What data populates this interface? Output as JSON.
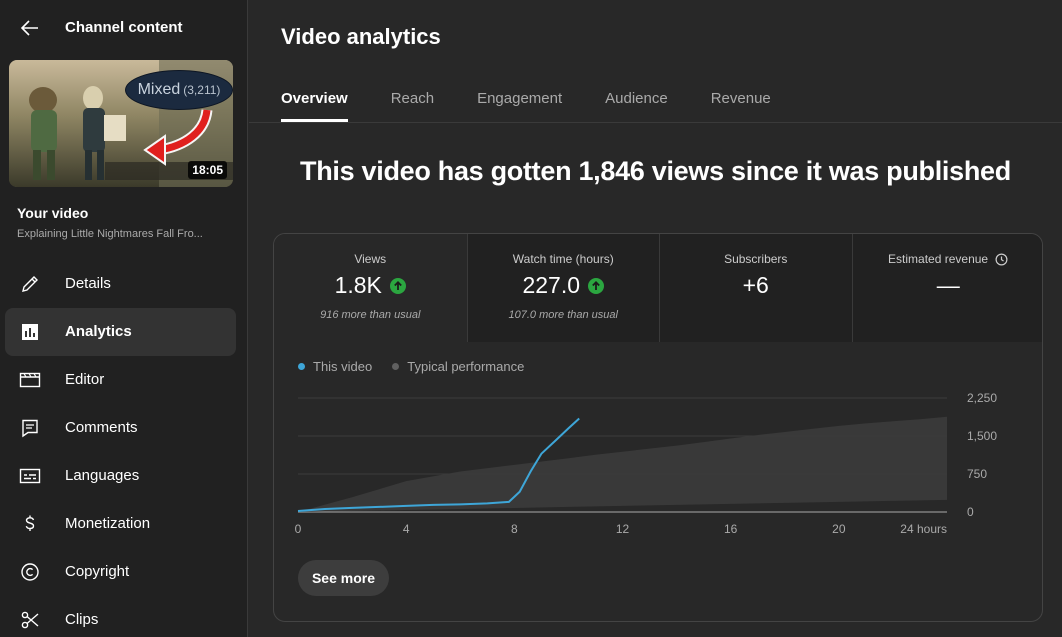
{
  "sidebar": {
    "title": "Channel content",
    "thumbnail": {
      "badge_word": "Mixed",
      "badge_count": "(3,211)",
      "duration": "18:05"
    },
    "your_video_label": "Your video",
    "video_title": "Explaining Little Nightmares Fall Fro...",
    "items": [
      {
        "label": "Details",
        "icon": "pencil-icon"
      },
      {
        "label": "Analytics",
        "icon": "analytics-icon",
        "active": true
      },
      {
        "label": "Editor",
        "icon": "editor-icon"
      },
      {
        "label": "Comments",
        "icon": "comments-icon"
      },
      {
        "label": "Languages",
        "icon": "languages-icon"
      },
      {
        "label": "Monetization",
        "icon": "dollar-icon"
      },
      {
        "label": "Copyright",
        "icon": "copyright-icon"
      },
      {
        "label": "Clips",
        "icon": "scissors-icon"
      }
    ]
  },
  "main": {
    "title": "Video analytics",
    "tabs": [
      {
        "label": "Overview",
        "active": true
      },
      {
        "label": "Reach"
      },
      {
        "label": "Engagement"
      },
      {
        "label": "Audience"
      },
      {
        "label": "Revenue"
      }
    ],
    "headline": "This video has gotten 1,846 views since it was published",
    "metrics": [
      {
        "label": "Views",
        "value": "1.8K",
        "trend": "up",
        "note": "916 more than usual"
      },
      {
        "label": "Watch time (hours)",
        "value": "227.0",
        "trend": "up",
        "note": "107.0 more than usual"
      },
      {
        "label": "Subscribers",
        "value": "+6",
        "note": ""
      },
      {
        "label": "Estimated revenue",
        "value": "—",
        "note": ""
      }
    ],
    "legend": {
      "this_video": "This video",
      "typical": "Typical performance"
    },
    "see_more": "See more"
  },
  "colors": {
    "this_video": "#3ea6d8",
    "typical": "#3a3a3a",
    "up_badge": "#2ba640"
  },
  "chart_data": {
    "type": "line",
    "x_tick_labels": [
      "0",
      "4",
      "8",
      "12",
      "16",
      "20",
      "24 hours"
    ],
    "x_ticks": [
      0,
      4,
      8,
      12,
      16,
      20,
      24
    ],
    "y_tick_labels": [
      "2,250",
      "1,500",
      "750",
      "0"
    ],
    "y_ticks": [
      2250,
      1500,
      750,
      0
    ],
    "xlim": [
      0,
      24
    ],
    "ylim": [
      0,
      2250
    ],
    "grid": true,
    "legend_position": "top-left",
    "series": [
      {
        "name": "This video",
        "x": [
          0,
          1,
          2,
          3,
          4,
          5,
          6,
          7,
          7.8,
          8.2,
          8.6,
          9,
          9.5,
          10,
          10.4
        ],
        "y": [
          20,
          60,
          80,
          100,
          120,
          140,
          150,
          170,
          200,
          400,
          800,
          1150,
          1400,
          1650,
          1846
        ]
      },
      {
        "name": "Typical performance",
        "band": true,
        "x": [
          0,
          2,
          4,
          6,
          8,
          10,
          11,
          12,
          13,
          14,
          15,
          16,
          17,
          18,
          19,
          20,
          21,
          22,
          23,
          24
        ],
        "y_upper": [
          0,
          290,
          610,
          800,
          930,
          1060,
          1130,
          1190,
          1250,
          1310,
          1380,
          1450,
          1520,
          1580,
          1640,
          1700,
          1750,
          1790,
          1830,
          1880
        ],
        "y_lower": [
          0,
          20,
          40,
          60,
          80,
          100,
          110,
          120,
          130,
          140,
          150,
          160,
          170,
          180,
          190,
          200,
          210,
          220,
          230,
          240
        ]
      }
    ]
  }
}
